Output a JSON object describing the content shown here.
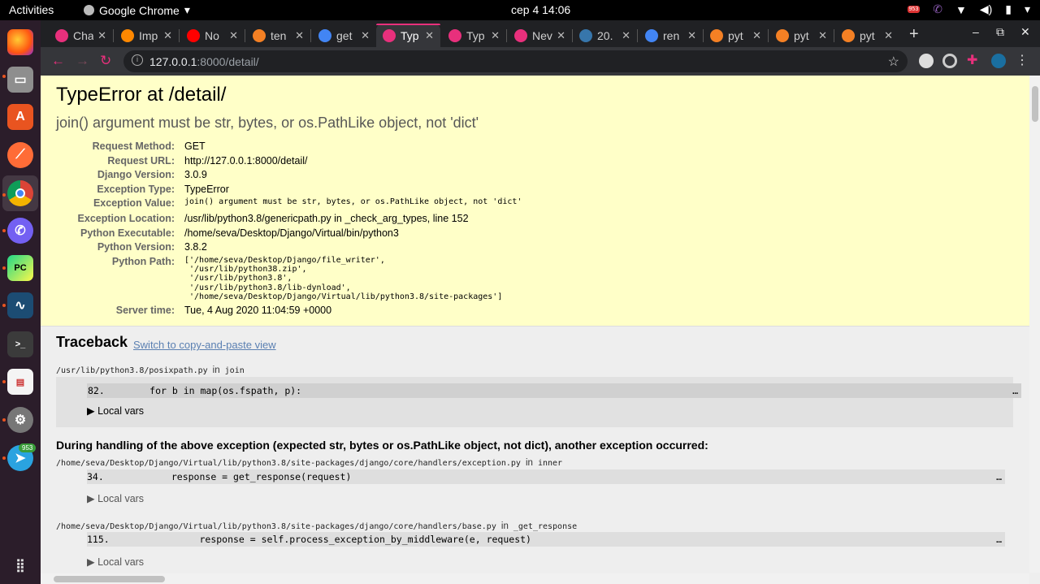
{
  "topbar": {
    "activities": "Activities",
    "app_name": "Google Chrome",
    "app_menu_arrow": "▾",
    "clock": "сер 4  14:06"
  },
  "dock": {
    "telegram_badge": "953",
    "apps": [
      "firefox-icon",
      "files-icon",
      "software-icon",
      "postman-icon",
      "chrome-icon",
      "viber-icon",
      "pycharm-icon",
      "mysql-workbench-icon",
      "terminal-icon",
      "document-viewer-icon",
      "settings-icon",
      "telegram-icon",
      "app-grid-icon"
    ]
  },
  "tabs": [
    {
      "title": "Cha",
      "color": "#e8307c"
    },
    {
      "title": "Imp",
      "color": "#ff8800"
    },
    {
      "title": "No",
      "color": "#ff0000"
    },
    {
      "title": "ten",
      "color": "#f48024"
    },
    {
      "title": "get",
      "color": "#4285f4"
    },
    {
      "title": "Typ",
      "color": "#e8307c"
    },
    {
      "title": "Typ",
      "color": "#e8307c"
    },
    {
      "title": "Nev",
      "color": "#e8307c"
    },
    {
      "title": "20.",
      "color": "#3776ab"
    },
    {
      "title": "ren",
      "color": "#4285f4"
    },
    {
      "title": "pyt",
      "color": "#f48024"
    },
    {
      "title": "pyt",
      "color": "#f48024"
    },
    {
      "title": "pyt",
      "color": "#f48024"
    }
  ],
  "omnibox": {
    "host": "127.0.0.1",
    "path": ":8000/detail/"
  },
  "error": {
    "title": "TypeError at /detail/",
    "message": "join() argument must be str, bytes, or os.PathLike object, not 'dict'",
    "meta": [
      {
        "key": "Request Method:",
        "value": "GET"
      },
      {
        "key": "Request URL:",
        "value": "http://127.0.0.1:8000/detail/"
      },
      {
        "key": "Django Version:",
        "value": "3.0.9"
      },
      {
        "key": "Exception Type:",
        "value": "TypeError"
      },
      {
        "key": "Exception Value:",
        "value": "join() argument must be str, bytes, or os.PathLike object, not 'dict'"
      },
      {
        "key": "Exception Location:",
        "value": "/usr/lib/python3.8/genericpath.py in _check_arg_types, line 152"
      },
      {
        "key": "Python Executable:",
        "value": "/home/seva/Desktop/Django/Virtual/bin/python3"
      },
      {
        "key": "Python Version:",
        "value": "3.8.2"
      },
      {
        "key": "Python Path:",
        "value": "['/home/seva/Desktop/Django/file_writer',\n '/usr/lib/python38.zip',\n '/usr/lib/python3.8',\n '/usr/lib/python3.8/lib-dynload',\n '/home/seva/Desktop/Django/Virtual/lib/python3.8/site-packages']"
      },
      {
        "key": "Server time:",
        "value": "Tue, 4 Aug 2020 11:04:59 +0000"
      }
    ]
  },
  "traceback": {
    "heading": "Traceback",
    "switch_link": "Switch to copy-and-paste view",
    "frame1": {
      "path": "/usr/lib/python3.8/posixpath.py",
      "in": "in",
      "func": "join",
      "line": "82.        for b in map(os.fspath, p):",
      "ellipsis": "…",
      "local_vars": "▶ Local vars"
    },
    "between_msg": "During handling of the above exception (expected str, bytes or os.PathLike object, not dict), another exception occurred:",
    "frame2": {
      "path": "/home/seva/Desktop/Django/Virtual/lib/python3.8/site-packages/django/core/handlers/exception.py",
      "in": "in",
      "func": "inner",
      "line": "34.            response = get_response(request)",
      "ellipsis": "…",
      "local_vars": "▶ Local vars"
    },
    "frame3": {
      "path": "/home/seva/Desktop/Django/Virtual/lib/python3.8/site-packages/django/core/handlers/base.py",
      "in": "in",
      "func": "_get_response",
      "line": "115.                response = self.process_exception_by_middleware(e, request)",
      "ellipsis": "…",
      "local_vars": "▶ Local vars"
    }
  }
}
